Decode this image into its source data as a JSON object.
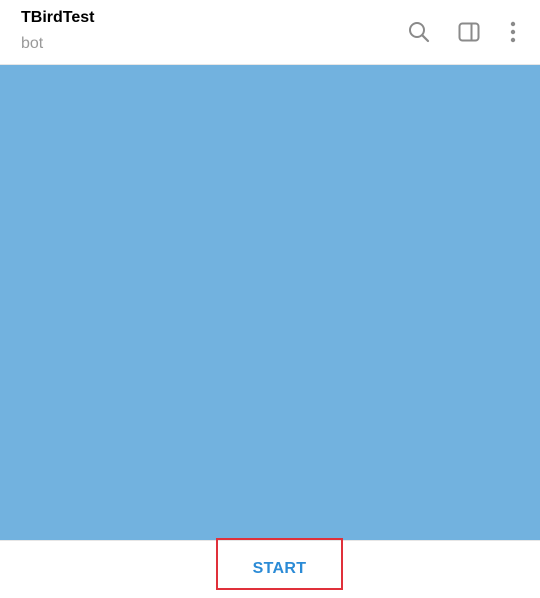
{
  "header": {
    "title": "TBirdTest",
    "subtitle": "bot",
    "icons": {
      "search": "search-icon",
      "sidebar": "sidebar-toggle-icon",
      "more": "more-vertical-icon"
    }
  },
  "chat": {
    "background_color": "#72b2df"
  },
  "footer": {
    "start_label": "START",
    "start_color": "#2b8bd6",
    "highlight_color": "#e0303a"
  }
}
